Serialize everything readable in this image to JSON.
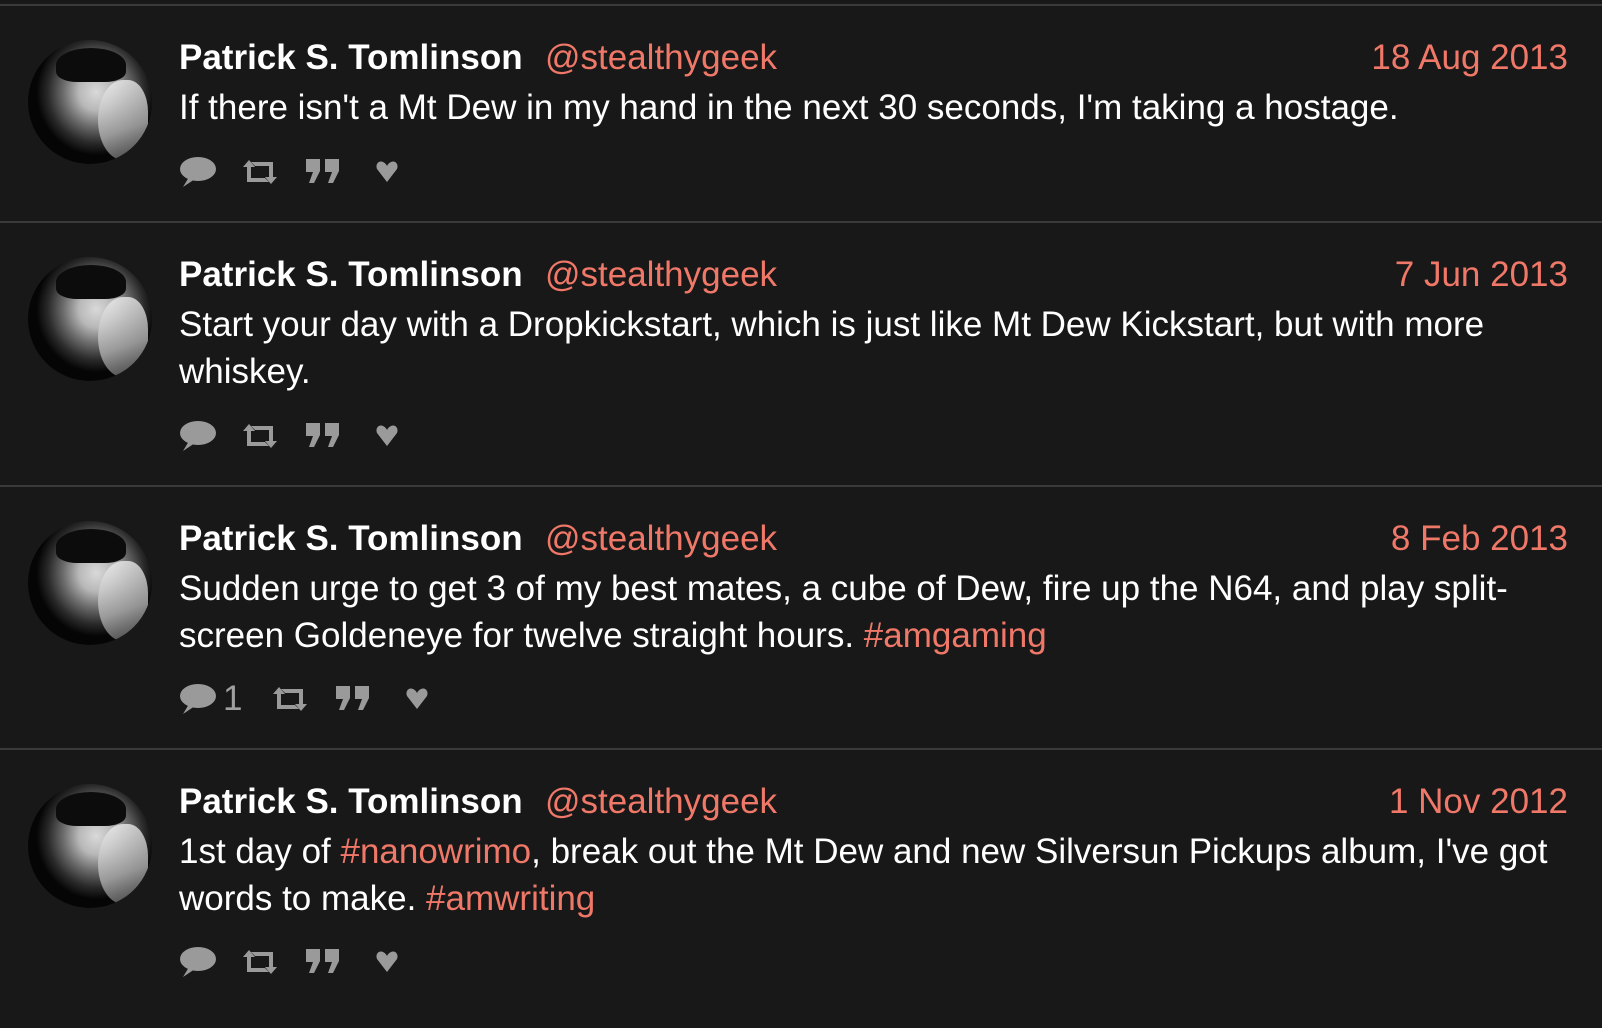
{
  "colors": {
    "background": "#181818",
    "accent": "#f07868",
    "text": "#ffffff",
    "icon": "#9a9a9a",
    "separator": "#3a3a3a"
  },
  "tweets": [
    {
      "name": "Patrick S. Tomlinson",
      "handle": "@stealthygeek",
      "date": "18 Aug 2013",
      "text": "If there isn't a Mt Dew in my hand in the next 30 seconds, I'm taking a hostage.",
      "reply_count": "",
      "icons": [
        "reply-icon",
        "retweet-icon",
        "quote-icon",
        "heart-icon"
      ]
    },
    {
      "name": "Patrick S. Tomlinson",
      "handle": "@stealthygeek",
      "date": "7 Jun 2013",
      "text": "Start your day with a Dropkickstart, which is just like Mt Dew Kickstart, but with more whiskey.",
      "reply_count": "",
      "icons": [
        "reply-icon",
        "retweet-icon",
        "quote-icon",
        "heart-icon"
      ]
    },
    {
      "name": "Patrick S. Tomlinson",
      "handle": "@stealthygeek",
      "date": "8 Feb 2013",
      "text_before": "Sudden urge to get 3 of my best mates, a cube of Dew, fire up the N64, and play split-screen Goldeneye for twelve straight hours. ",
      "hashtag": "#amgaming",
      "reply_count": "1",
      "icons": [
        "reply-icon",
        "retweet-icon",
        "quote-icon",
        "heart-icon"
      ]
    },
    {
      "name": "Patrick S. Tomlinson",
      "handle": "@stealthygeek",
      "date": "1 Nov 2012",
      "text_a": "1st day of ",
      "hashtag_a": "#nanowrimo",
      "text_b": ", break out the Mt Dew and new Silversun Pickups album, I've got words to make. ",
      "hashtag_b": "#amwriting",
      "reply_count": "",
      "icons": [
        "reply-icon",
        "retweet-icon",
        "quote-icon",
        "heart-icon"
      ]
    }
  ]
}
